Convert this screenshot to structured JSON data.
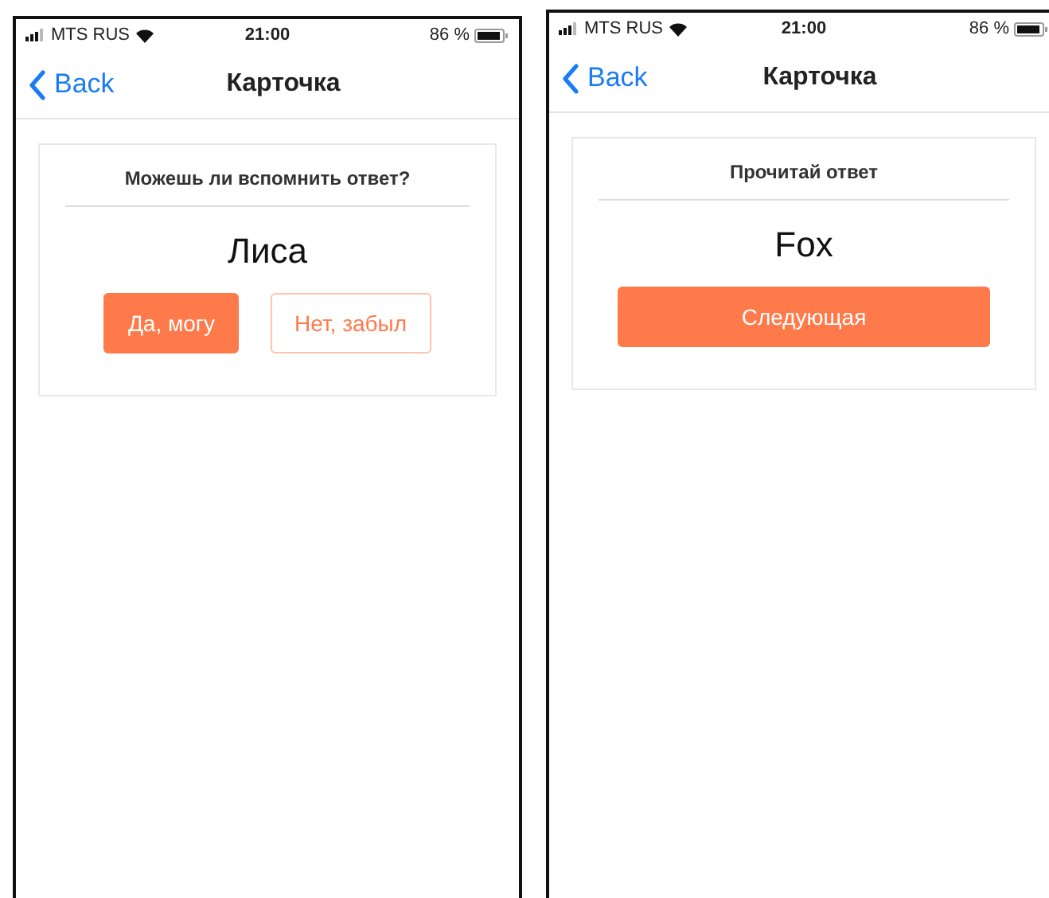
{
  "screens": [
    {
      "status_bar": {
        "carrier": "MTS RUS",
        "time": "21:00",
        "battery": "86 %"
      },
      "nav_bar": {
        "back": "Back",
        "title": "Карточка"
      },
      "card": {
        "prompt": "Можешь ли вспомнить ответ?",
        "word": "Лиса",
        "buttons": [
          {
            "label": "Да, могу",
            "kind": "primary"
          },
          {
            "label": "Нет, забыл",
            "kind": "outline"
          }
        ]
      }
    },
    {
      "status_bar": {
        "carrier": "MTS RUS",
        "time": "21:00",
        "battery": "86 %"
      },
      "nav_bar": {
        "back": "Back",
        "title": "Карточка"
      },
      "card": {
        "prompt": "Прочитай ответ",
        "word": "Fox",
        "buttons": [
          {
            "label": "Следующая",
            "kind": "wide"
          }
        ]
      }
    }
  ]
}
